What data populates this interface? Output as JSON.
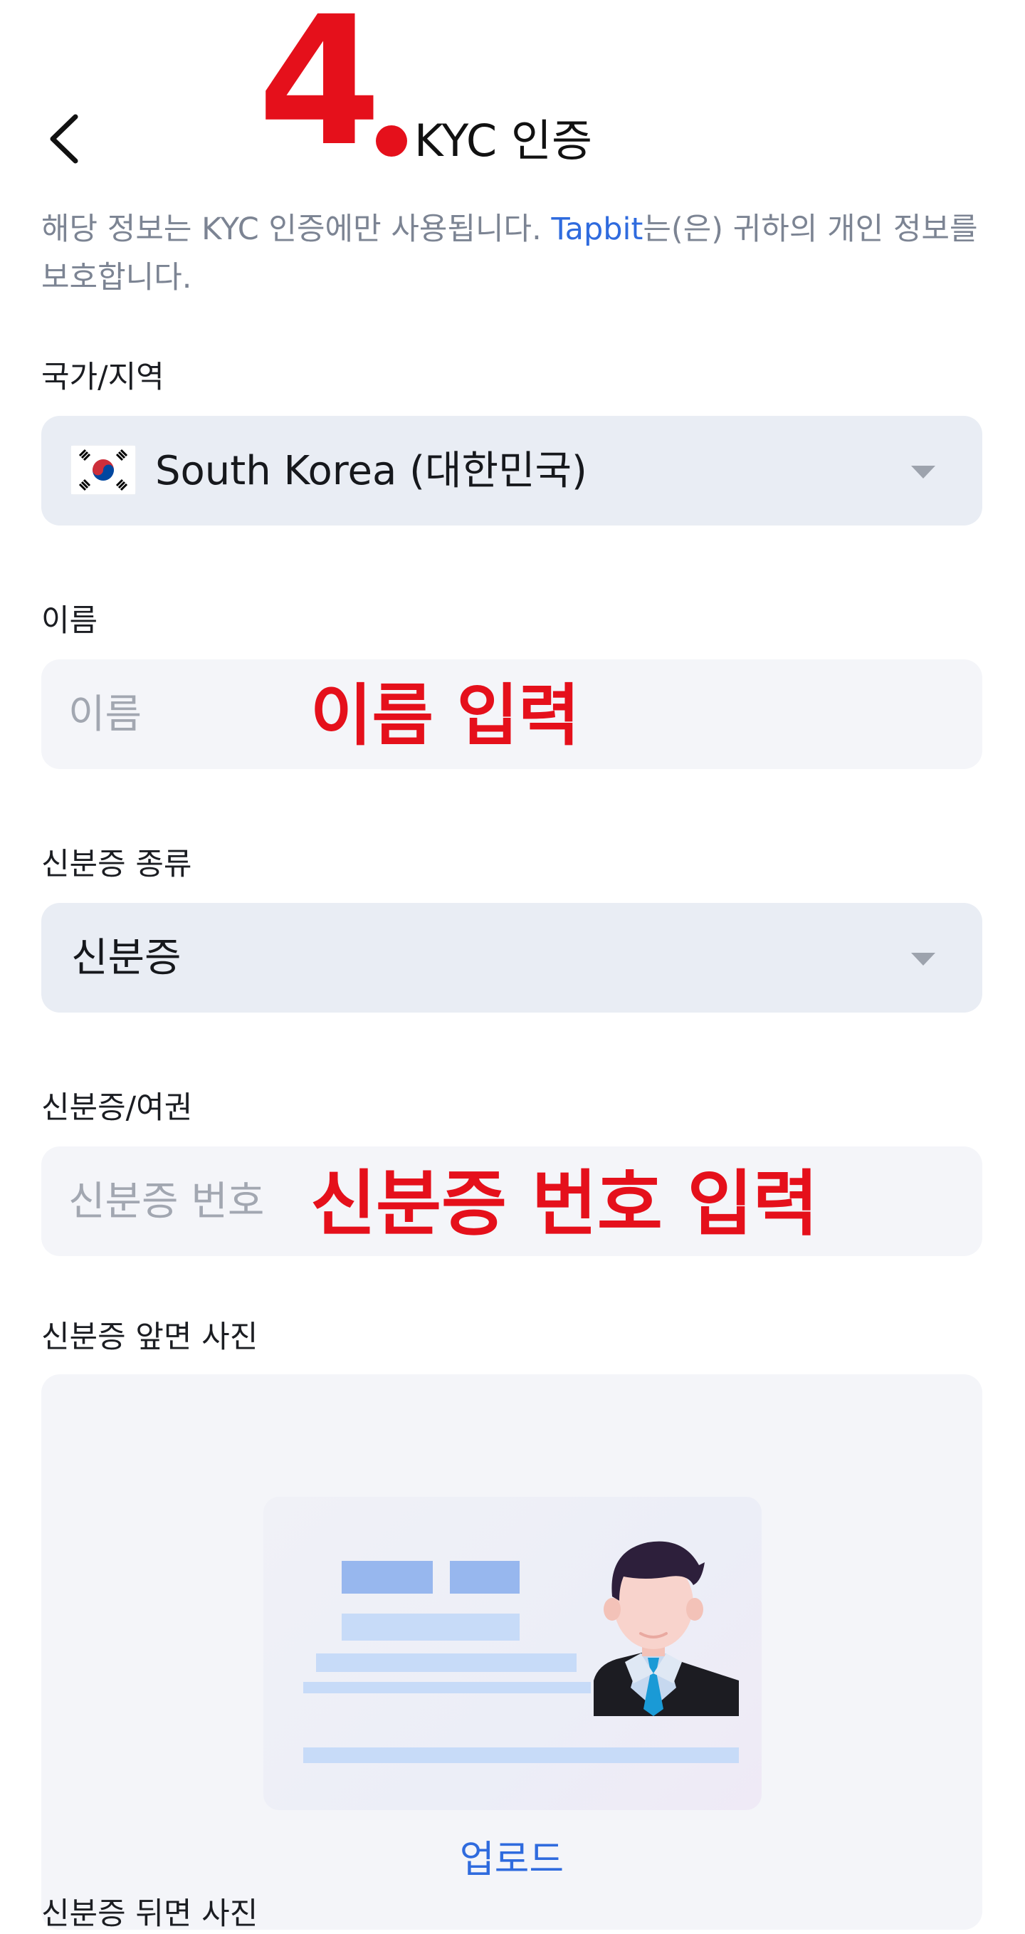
{
  "header": {
    "step_number": "4",
    "title": "KYC 인증"
  },
  "notice": {
    "text_before": "해당 정보는 KYC 인증에만 사용됩니다. ",
    "brand": "Tapbit",
    "text_after": "는(은) 귀하의 개인 정보를 보호합니다."
  },
  "country": {
    "label": "국가/지역",
    "value": "South Korea (대한민국)",
    "flag_icon": "south-korea-flag-icon"
  },
  "name": {
    "label": "이름",
    "placeholder": "이름",
    "annotation": "이름 입력"
  },
  "id_type": {
    "label": "신분증 종류",
    "value": "신분증"
  },
  "id_number": {
    "label": "신분증/여권",
    "placeholder": "신분증 번호",
    "annotation": "신분증 번호 입력"
  },
  "front_photo": {
    "label": "신분증 앞면 사진",
    "upload_label": "업로드",
    "illustration_icon": "id-card-illustration"
  },
  "back_photo": {
    "label": "신분증 뒤면 사진"
  },
  "colors": {
    "accent_blue": "#2f6bde",
    "annotation_red": "#e5101b",
    "select_bg": "#e9edf4",
    "input_bg": "#f4f5f9"
  }
}
